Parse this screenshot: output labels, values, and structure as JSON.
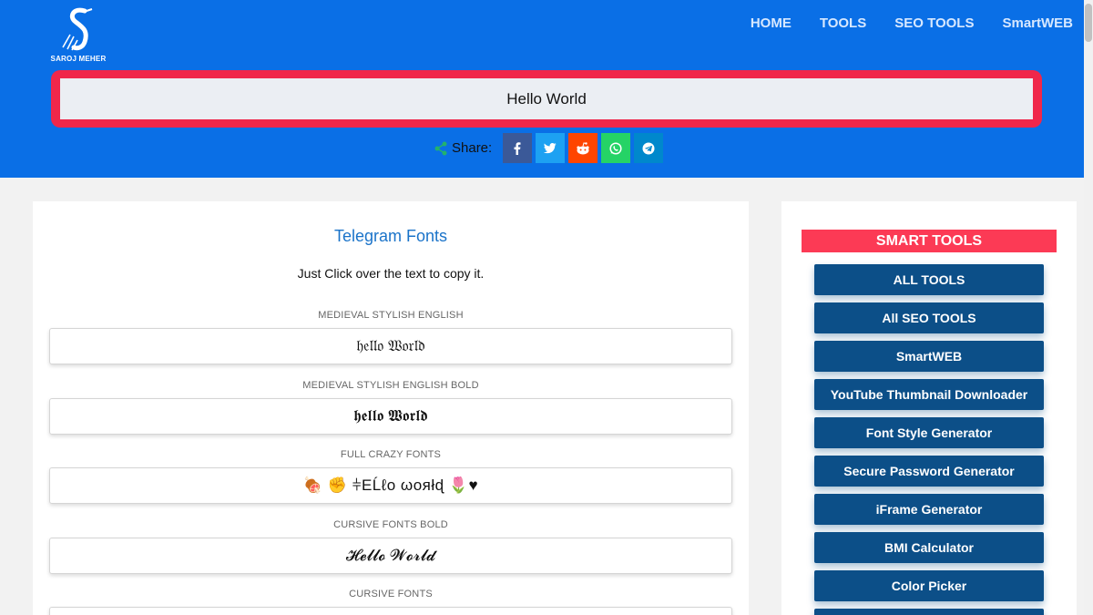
{
  "brand": {
    "logo_text": "SAROJ MEHER"
  },
  "nav": [
    {
      "label": "HOME"
    },
    {
      "label": "TOOLS"
    },
    {
      "label": "SEO TOOLS"
    },
    {
      "label": "SmartWEB"
    }
  ],
  "input": {
    "value": "Hello World"
  },
  "share": {
    "label": "Share:",
    "buttons": [
      {
        "name": "facebook",
        "icon": "facebook-icon",
        "color": "#3b5998"
      },
      {
        "name": "twitter",
        "icon": "twitter-icon",
        "color": "#1da1f2"
      },
      {
        "name": "reddit",
        "icon": "reddit-icon",
        "color": "#ff4500"
      },
      {
        "name": "whatsapp",
        "icon": "whatsapp-icon",
        "color": "#25d366"
      },
      {
        "name": "telegram",
        "icon": "telegram-icon",
        "color": "#0088cc"
      }
    ]
  },
  "main": {
    "title": "Telegram Fonts",
    "subtitle": "Just Click over the text to copy it.",
    "fonts": [
      {
        "label": "MEDIEVAL STYLISH ENGLISH",
        "text": "𝔥𝔢𝔩𝔩𝔬 𝔚𝔬𝔯𝔩𝔡"
      },
      {
        "label": "MEDIEVAL STYLISH ENGLISH BOLD",
        "text": "𝖍𝖊𝖑𝖑𝖔 𝖂𝖔𝖗𝖑𝖉"
      },
      {
        "label": "FULL CRAZY FONTS",
        "text": "🍖 ✊ ⫩ΕĹℓo ωoяłɖ 🌷♥"
      },
      {
        "label": "CURSIVE FONTS BOLD",
        "text": "𝓗𝓮𝓵𝓵𝓸 𝓦𝓸𝓻𝓵𝓭"
      },
      {
        "label": "CURSIVE FONTS",
        "text": ""
      }
    ]
  },
  "sidebar": {
    "title": "SMART TOOLS",
    "items": [
      {
        "label": "ALL TOOLS"
      },
      {
        "label": "All SEO TOOLS"
      },
      {
        "label": "SmartWEB"
      },
      {
        "label": "YouTube Thumbnail Downloader"
      },
      {
        "label": "Font Style Generator"
      },
      {
        "label": "Secure Password Generator"
      },
      {
        "label": "iFrame Generator"
      },
      {
        "label": "BMI Calculator"
      },
      {
        "label": "Color Picker"
      },
      {
        "label": ""
      }
    ]
  },
  "colors": {
    "header_bg": "#0a6fe6",
    "input_border": "#f0274a",
    "sidebar_title_bg": "#fc3a55",
    "sidebar_btn_bg": "#0c4f88",
    "title_blue": "#1a73c9"
  }
}
